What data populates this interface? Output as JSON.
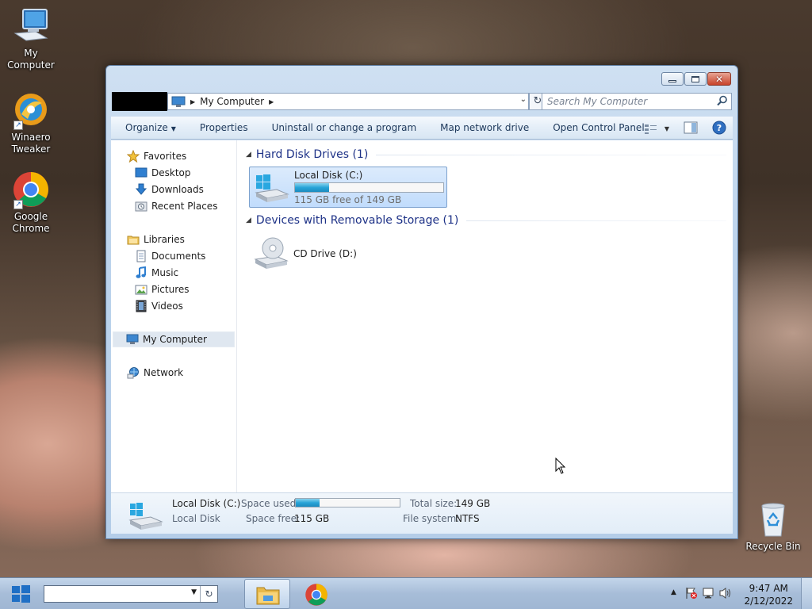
{
  "desktop": {
    "icons": [
      {
        "label": "My Computer"
      },
      {
        "label": "Winaero\nTweaker"
      },
      {
        "label": "Google\nChrome"
      },
      {
        "label": "Recycle Bin"
      }
    ]
  },
  "window": {
    "address": {
      "crumb": "My Computer"
    },
    "search": {
      "placeholder": "Search My Computer"
    },
    "toolbar": {
      "organize": "Organize",
      "properties": "Properties",
      "uninstall": "Uninstall or change a program",
      "map_drive": "Map network drive",
      "control_panel": "Open Control Panel"
    },
    "nav": {
      "favorites": "Favorites",
      "desktop": "Desktop",
      "downloads": "Downloads",
      "recent": "Recent Places",
      "libraries": "Libraries",
      "documents": "Documents",
      "music": "Music",
      "pictures": "Pictures",
      "videos": "Videos",
      "my_computer": "My Computer",
      "network": "Network"
    },
    "groups": {
      "hdd": "Hard Disk Drives (1)",
      "removable": "Devices with Removable Storage (1)"
    },
    "drives": {
      "c": {
        "name": "Local Disk (C:)",
        "free": "115 GB free of 149 GB",
        "used_fraction": 0.23
      },
      "d": {
        "name": "CD Drive (D:)"
      }
    },
    "details": {
      "name": "Local Disk (C:)",
      "type": "Local Disk",
      "space_used_label": "Space used:",
      "space_free_label": "Space free:",
      "space_free": "115 GB",
      "total_size_label": "Total size:",
      "total_size": "149 GB",
      "fs_label": "File system:",
      "fs": "NTFS",
      "used_fraction": 0.23
    }
  },
  "taskbar": {
    "time": "9:47 AM",
    "date": "2/12/2022"
  },
  "colors": {
    "accent": "#1e3287",
    "progress": "#27a4d8"
  }
}
